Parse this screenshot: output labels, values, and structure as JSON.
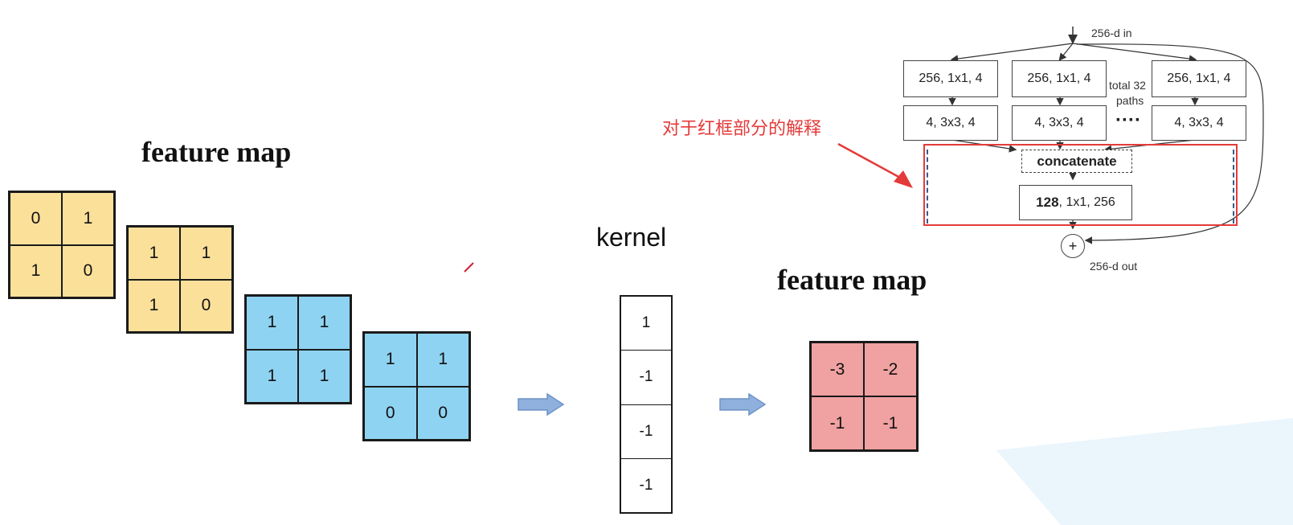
{
  "left_title": "feature map",
  "input_maps": [
    {
      "values": [
        "0",
        "1",
        "1",
        "0"
      ],
      "color": "#fbe09a"
    },
    {
      "values": [
        "1",
        "1",
        "1",
        "0"
      ],
      "color": "#fbe09a"
    },
    {
      "values": [
        "1",
        "1",
        "1",
        "1"
      ],
      "color": "#8fd3f2"
    },
    {
      "values": [
        "1",
        "1",
        "0",
        "0"
      ],
      "color": "#8fd3f2"
    }
  ],
  "kernel": {
    "title": "kernel",
    "values": [
      "1",
      "-1",
      "-1",
      "-1"
    ]
  },
  "output": {
    "title": "feature map",
    "values": [
      "-3",
      "-2",
      "-1",
      "-1"
    ],
    "color": "#f0a1a1"
  },
  "annotation": "对于红框部分的解释",
  "block": {
    "input_label": "256-d in",
    "output_label": "256-d out",
    "row1": [
      "256, 1x1, 4",
      "256, 1x1, 4",
      "256, 1x1, 4"
    ],
    "row2": [
      "4, 3x3, 4",
      "4, 3x3, 4",
      "4, 3x3, 4"
    ],
    "paths_label_1": "total 32",
    "paths_label_2": "paths",
    "dots": "····",
    "concatenate": "concatenate",
    "final_bold": "128",
    "final_rest": ", 1x1, 256",
    "plus": "+"
  },
  "colors": {
    "highlight": "#e53a3a",
    "arrow_fill": "#8fb0dc",
    "arrow_stroke": "#6f93c8",
    "watermark": "#eaf5fc"
  }
}
